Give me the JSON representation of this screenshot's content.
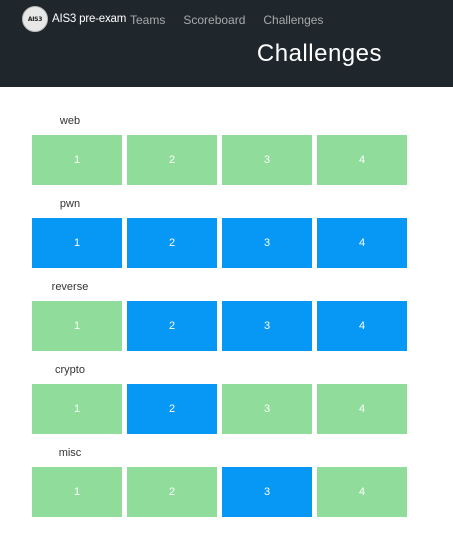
{
  "navbar": {
    "logo_text": "AIS3",
    "brand": "AIS3 pre-exam",
    "links": [
      "Teams",
      "Scoreboard",
      "Challenges"
    ],
    "title": "Challenges"
  },
  "colors": {
    "solved": "#90dc9a",
    "unsolved": "#0797f4",
    "navbar_bg": "#1f272c"
  },
  "categories": [
    {
      "name": "web",
      "challenges": [
        {
          "label": "1",
          "state": "solved"
        },
        {
          "label": "2",
          "state": "solved"
        },
        {
          "label": "3",
          "state": "solved"
        },
        {
          "label": "4",
          "state": "solved"
        }
      ]
    },
    {
      "name": "pwn",
      "challenges": [
        {
          "label": "1",
          "state": "unsolved"
        },
        {
          "label": "2",
          "state": "unsolved"
        },
        {
          "label": "3",
          "state": "unsolved"
        },
        {
          "label": "4",
          "state": "unsolved"
        }
      ]
    },
    {
      "name": "reverse",
      "challenges": [
        {
          "label": "1",
          "state": "solved"
        },
        {
          "label": "2",
          "state": "unsolved"
        },
        {
          "label": "3",
          "state": "unsolved"
        },
        {
          "label": "4",
          "state": "unsolved"
        }
      ]
    },
    {
      "name": "crypto",
      "challenges": [
        {
          "label": "1",
          "state": "solved"
        },
        {
          "label": "2",
          "state": "unsolved"
        },
        {
          "label": "3",
          "state": "solved"
        },
        {
          "label": "4",
          "state": "solved"
        }
      ]
    },
    {
      "name": "misc",
      "challenges": [
        {
          "label": "1",
          "state": "solved"
        },
        {
          "label": "2",
          "state": "solved"
        },
        {
          "label": "3",
          "state": "unsolved"
        },
        {
          "label": "4",
          "state": "solved"
        }
      ]
    }
  ]
}
